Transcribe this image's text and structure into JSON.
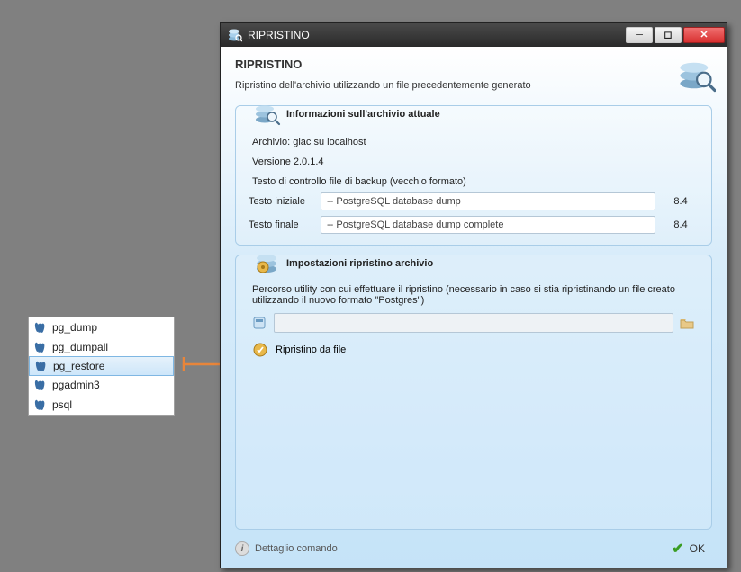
{
  "context_menu": {
    "items": [
      {
        "label": "pg_dump"
      },
      {
        "label": "pg_dumpall"
      },
      {
        "label": "pg_restore",
        "selected": true
      },
      {
        "label": "pgadmin3"
      },
      {
        "label": "psql"
      }
    ]
  },
  "window": {
    "title": "RIPRISTINO",
    "header": {
      "title": "RIPRISTINO",
      "subtitle": "Ripristino dell'archivio utilizzando un file precedentemente generato"
    },
    "panel_info": {
      "title": "Informazioni sull'archivio attuale",
      "archive_label": "Archivio: giac su localhost",
      "version_label": "Versione 2.0.1.4",
      "check_text_label": "Testo di controllo file di backup (vecchio formato)",
      "row1": {
        "label": "Testo iniziale",
        "value": "-- PostgreSQL database dump",
        "ver": "8.4"
      },
      "row2": {
        "label": "Testo finale",
        "value": "-- PostgreSQL database dump complete",
        "ver": "8.4"
      }
    },
    "panel_settings": {
      "title": "Impostazioni ripristino archivio",
      "desc": "Percorso utility con cui effettuare il ripristino (necessario in caso si stia ripristinando un file creato utilizzando il nuovo formato \"Postgres\")",
      "path_value": "",
      "restore_from_file_label": "Ripristino da file"
    },
    "footer": {
      "detail_label": "Dettaglio comando",
      "ok_label": "OK"
    }
  }
}
